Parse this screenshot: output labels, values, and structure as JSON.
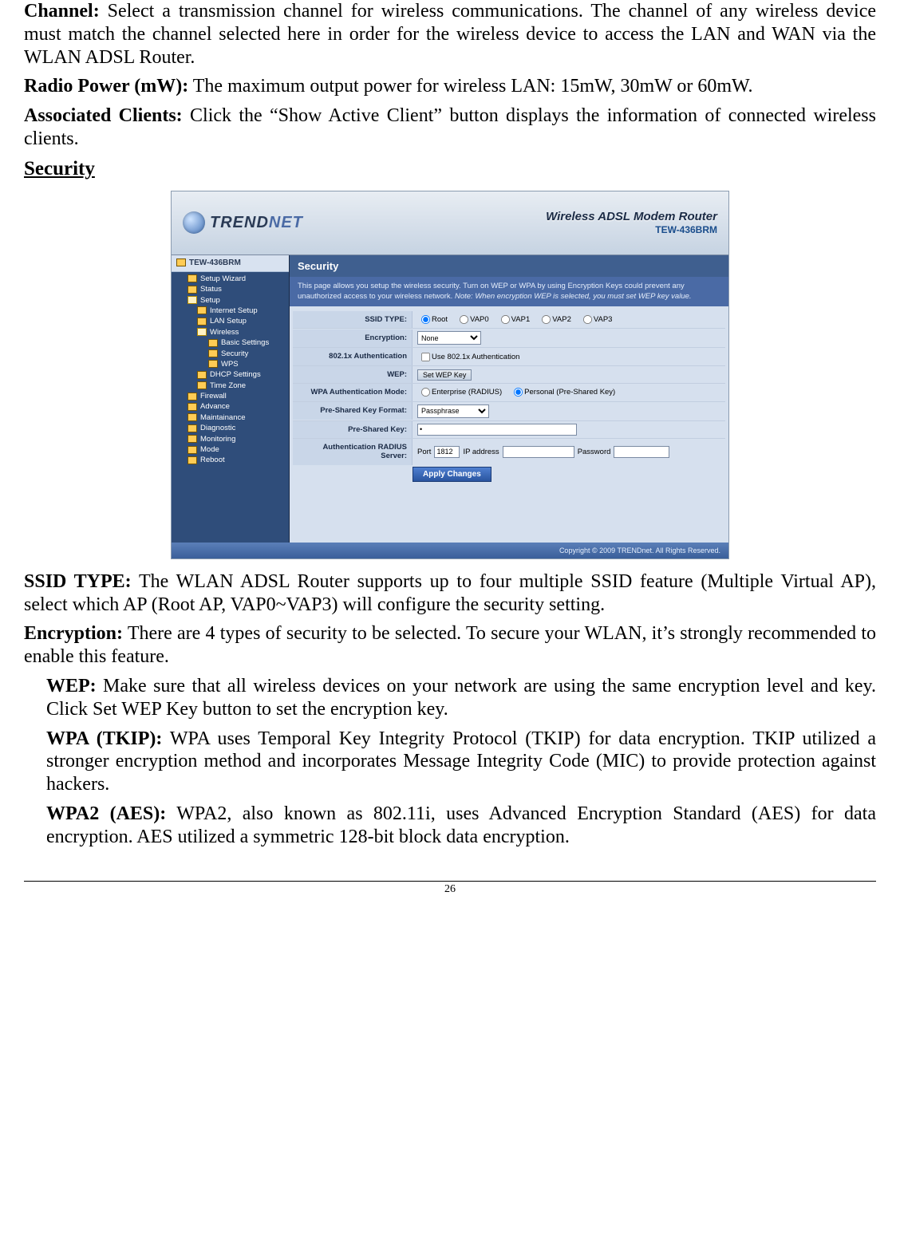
{
  "p_channel_label": "Channel:",
  "p_channel_text": " Select a transmission channel for wireless communications. The channel of any wireless device must match the channel selected here in order for the wireless device to access the LAN and WAN via the WLAN ADSL Router.",
  "p_radio_label": "Radio Power (mW):",
  "p_radio_text": " The maximum output power for wireless LAN: 15mW, 30mW or 60mW.",
  "p_assoc_label": "Associated Clients:",
  "p_assoc_text": " Click the “Show Active Client” button displays the information of connected wireless clients.",
  "h_security": "Security",
  "ss": {
    "brand": "TREND",
    "brand2": "NET",
    "header_main": "Wireless ADSL Modem Router",
    "header_sub": "TEW-436BRM",
    "tree_root": "TEW-436BRM",
    "nav": {
      "setup_wizard": "Setup Wizard",
      "status": "Status",
      "setup": "Setup",
      "internet_setup": "Internet Setup",
      "lan_setup": "LAN Setup",
      "wireless": "Wireless",
      "basic_settings": "Basic Settings",
      "security": "Security",
      "wps": "WPS",
      "dhcp": "DHCP Settings",
      "timezone": "Time Zone",
      "firewall": "Firewall",
      "advance": "Advance",
      "maint": "Maintainance",
      "diag": "Diagnostic",
      "monitoring": "Monitoring",
      "mode": "Mode",
      "reboot": "Reboot"
    },
    "main_title": "Security",
    "main_desc_a": "This page allows you setup the wireless security. Turn on WEP or WPA by using Encryption Keys could prevent any unauthorized access to your wireless network. ",
    "main_desc_b": "Note: When encryption WEP is selected, you must set WEP key value.",
    "rows": {
      "ssid_label": "SSID TYPE:",
      "ssid_opts": {
        "root": "Root",
        "vap0": "VAP0",
        "vap1": "VAP1",
        "vap2": "VAP2",
        "vap3": "VAP3"
      },
      "enc_label": "Encryption:",
      "enc_value": "None",
      "auth8021x_label": "802.1x Authentication",
      "auth8021x_chk": "Use 802.1x Authentication",
      "wep_label": "WEP:",
      "wep_btn": "Set WEP Key",
      "wpa_auth_label": "WPA Authentication Mode:",
      "wpa_opt_ent": "Enterprise (RADIUS)",
      "wpa_opt_psk": "Personal (Pre-Shared Key)",
      "psk_fmt_label": "Pre-Shared Key Format:",
      "psk_fmt_value": "Passphrase",
      "psk_label": "Pre-Shared Key:",
      "radius_label": "Authentication RADIUS Server:",
      "radius_port_l": "Port",
      "radius_port_v": "1812",
      "radius_ip_l": "IP address",
      "radius_pw_l": "Password",
      "apply": "Apply Changes"
    },
    "footer": "Copyright © 2009 TRENDnet. All Rights Reserved."
  },
  "p_ssid_label": "SSID TYPE:",
  "p_ssid_text": "  The WLAN ADSL Router supports up to four multiple SSID feature (Multiple Virtual AP), select which AP (Root AP, VAP0~VAP3) will configure the security setting.",
  "p_enc_label": "Encryption:",
  "p_enc_text": "  There are 4 types of security to be selected. To secure your WLAN, it’s strongly recommended to enable this feature.",
  "p_wep_label": "WEP:",
  "p_wep_text": " Make sure that all wireless devices on your network are using the same encryption level and key. Click Set WEP Key button to set the encryption key.",
  "p_wpa_t_label": "WPA (TKIP):",
  "p_wpa_t_text": " WPA uses Temporal Key Integrity Protocol (TKIP) for data encryption. TKIP utilized a stronger encryption method and incorporates Message Integrity Code (MIC) to provide protection against hackers.",
  "p_wpa2_label": "WPA2 (AES):",
  "p_wpa2_text": " WPA2, also known as 802.11i, uses Advanced Encryption Standard (AES) for data encryption. AES utilized a symmetric 128-bit block data encryption.",
  "page_num": "26"
}
